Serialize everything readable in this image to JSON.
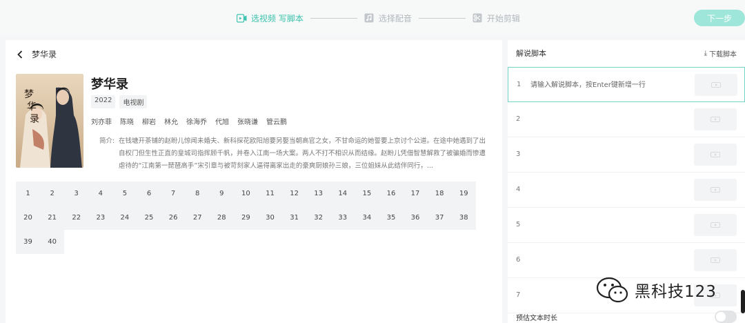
{
  "steps": [
    {
      "label": "选视频 写脚本",
      "icon": "video-icon",
      "active": true
    },
    {
      "label": "选择配音",
      "icon": "music-icon",
      "active": false
    },
    {
      "label": "开始剪辑",
      "icon": "scissors-icon",
      "active": false
    }
  ],
  "next_label": "下一步",
  "header": {
    "back_label": "梦华录"
  },
  "show": {
    "title": "梦华录",
    "year": "2022",
    "type": "电视剧",
    "cast": [
      "刘亦菲",
      "陈晓",
      "柳岩",
      "林允",
      "徐海乔",
      "代旭",
      "张晓谦",
      "管云鹏"
    ],
    "synopsis_label": "简介:",
    "synopsis": "在钱塘开茶铺的赵盼儿惊闻未婚夫、新科探花欧阳旭要另娶当朝高官之女，不甘命运的她誓要上京讨个公道。在途中她遇到了出自权门但生性正直的皇城司指挥顾千帆，并卷入江南一场大案。两人不打不相识从而结缘。赵盼儿凭借智慧解救了被骗婚而惨遭虐待的“江南第一琵琶高手”宋引章与被苛刻家人逼得离家出走的豪爽厨娘孙三娘，三位姐妹从此结伴同行，..."
  },
  "episodes": [
    "1",
    "2",
    "3",
    "4",
    "5",
    "6",
    "7",
    "8",
    "9",
    "10",
    "11",
    "12",
    "13",
    "14",
    "15",
    "16",
    "17",
    "18",
    "19",
    "20",
    "21",
    "22",
    "23",
    "24",
    "25",
    "26",
    "27",
    "28",
    "29",
    "30",
    "31",
    "32",
    "33",
    "34",
    "35",
    "36",
    "37",
    "38",
    "39",
    "40"
  ],
  "script": {
    "title": "解说脚本",
    "download_label": "下载脚本",
    "placeholder": "请输入解说脚本，按Enter键新增一行",
    "rows": [
      "1",
      "2",
      "3",
      "4",
      "5",
      "6",
      "7"
    ],
    "duration_label": "预估文本时长"
  },
  "watermark": "黑科技123",
  "colors": {
    "accent": "#3dc3ae",
    "next_button": "#9fe6da"
  }
}
